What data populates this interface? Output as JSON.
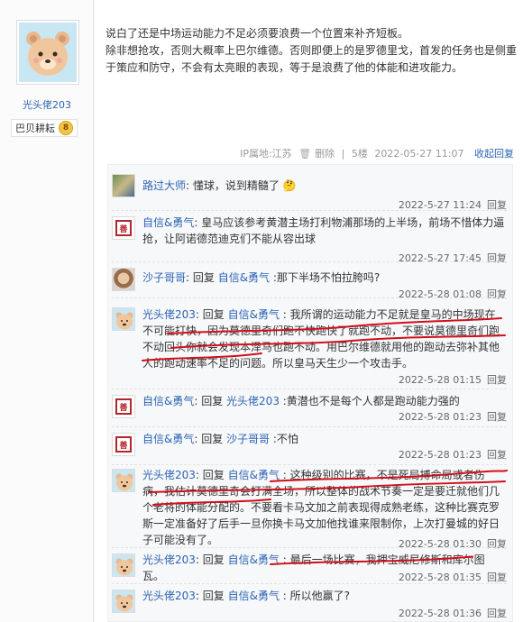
{
  "author": {
    "name": "光头佬203",
    "badge_label": "巴贝耕耘",
    "badge_level": "8"
  },
  "post": {
    "paragraph1": "说白了还是中场运动能力不足必须要浪费一个位置来补齐短板。",
    "paragraph2": "除非想抢攻，否则大概率上巴尔维德。否则即便上的是罗德里戈，首发的任务也是侧重于策应和防守，不会有太亮眼的表现，等于是浪费了他的体能和进攻能力。",
    "ip": "IP属地:江苏",
    "delete": "删除",
    "floor": "5楼",
    "time": "2022-05-27 11:07",
    "collapse_reply": "收起回复"
  },
  "comments": [
    {
      "name": "路过大师",
      "reply_prefix": "",
      "reply_to": "",
      "text": ": 懂球，说到精髓了",
      "emoji": "🤔",
      "time": "2022-5-27 11:24",
      "action": "回复"
    },
    {
      "name": "自信&勇气",
      "reply_prefix": "",
      "reply_to": "",
      "text": ": 皇马应该参考黄潜主场打利物浦那场的上半场，前场不惜体力逼抢，让阿诺德范迪克们不能从容出球",
      "time": "2022-5-27 17:45",
      "action": "回复"
    },
    {
      "name": "沙子哥哥",
      "reply_prefix": ": 回复 ",
      "reply_to": "自信&勇气",
      "text": " :那下半场不怕拉胯吗?",
      "time": "2022-5-28 01:08",
      "action": "回复"
    },
    {
      "name": "光头佬203",
      "reply_prefix": ": 回复 ",
      "reply_to": "自信&勇气",
      "text": " : 我所谓的运动能力不足就是皇马的中场现在不可能打快，因为莫德里奇们跑不快跑快了就跑不动，不要说莫德里奇们跑不动回头你就会发现本泽马也跑不动。用巴尔维德就用他的跑动去弥补其他人的跑动速率不足的问题。所以皇马天生少一个攻击手。",
      "time": "2022-5-28 01:15",
      "action": "回复"
    },
    {
      "name": "自信&勇气",
      "reply_prefix": ": 回复 ",
      "reply_to": "光头佬203",
      "text": " :黄潜也不是每个人都是跑动能力强的",
      "time": "2022-5-28 01:23",
      "action": "回复"
    },
    {
      "name": "自信&勇气",
      "reply_prefix": ": 回复 ",
      "reply_to": "沙子哥哥",
      "text": " :不怕",
      "time": "2022-5-28 01:23",
      "action": "回复"
    },
    {
      "name": "光头佬203",
      "reply_prefix": ": 回复 ",
      "reply_to": "自信&勇气",
      "text": " : 这种级别的比赛，不是死局搏命局或者伤病，我估计莫德里奇会打满全场，所以整体的战术节奏一定是要迁就他们几个老将的体能分配的。不要看卡马文加之前表现得成熟老练，这种比赛克罗斯一定准备好了后手一旦你换卡马文加他找谁来限制你，上次打曼城的好日子可能没有了。",
      "time": "2022-5-28 01:30",
      "action": "回复"
    },
    {
      "name": "光头佬203",
      "reply_prefix": ": 回复 ",
      "reply_to": "自信&勇气",
      "text": " : 最后一场比赛，我押宝威尼修斯和库尔图瓦。",
      "time": "2022-5-28 01:35",
      "action": "回复"
    },
    {
      "name": "光头佬203",
      "reply_prefix": ": 回复 ",
      "reply_to": "自信&勇气",
      "text": " : 所以他赢了?",
      "time": "2022-5-28 01:36",
      "action": "回复"
    }
  ],
  "icons": {
    "bear": "bear-avatar-icon",
    "stamp": "seal-avatar-icon"
  },
  "colors": {
    "link": "#2d64b3",
    "annotation": "#d0101a"
  }
}
